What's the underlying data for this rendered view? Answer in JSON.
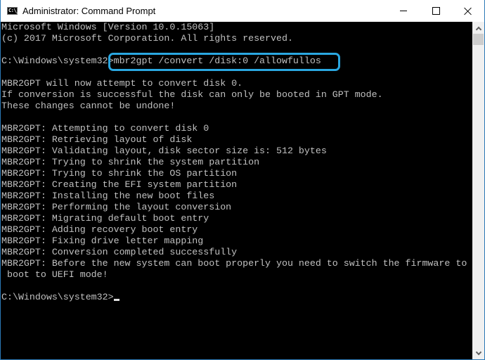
{
  "window": {
    "title": "Administrator: Command Prompt",
    "icon": "cmd-icon",
    "icon_glyph": "C:\\_",
    "controls": {
      "minimize": "minimize-icon",
      "maximize": "maximize-icon",
      "close": "close-icon"
    }
  },
  "console": {
    "lines": [
      "Microsoft Windows [Version 10.0.15063]",
      "(c) 2017 Microsoft Corporation. All rights reserved.",
      "",
      "C:\\Windows\\system32>mbr2gpt /convert /disk:0 /allowfullos",
      "",
      "MBR2GPT will now attempt to convert disk 0.",
      "If conversion is successful the disk can only be booted in GPT mode.",
      "These changes cannot be undone!",
      "",
      "MBR2GPT: Attempting to convert disk 0",
      "MBR2GPT: Retrieving layout of disk",
      "MBR2GPT: Validating layout, disk sector size is: 512 bytes",
      "MBR2GPT: Trying to shrink the system partition",
      "MBR2GPT: Trying to shrink the OS partition",
      "MBR2GPT: Creating the EFI system partition",
      "MBR2GPT: Installing the new boot files",
      "MBR2GPT: Performing the layout conversion",
      "MBR2GPT: Migrating default boot entry",
      "MBR2GPT: Adding recovery boot entry",
      "MBR2GPT: Fixing drive letter mapping",
      "MBR2GPT: Conversion completed successfully",
      "MBR2GPT: Before the new system can boot properly you need to switch the firmware to",
      " boot to UEFI mode!",
      "",
      "C:\\Windows\\system32>"
    ],
    "highlighted_command": "mbr2gpt /convert /disk:0 /allowfullos",
    "highlight_color": "#2aa7e1",
    "text_color": "#c0c0c0",
    "background_color": "#000000"
  },
  "scrollbar": {
    "up": "scroll-up-arrow-icon",
    "down": "scroll-down-arrow-icon"
  }
}
